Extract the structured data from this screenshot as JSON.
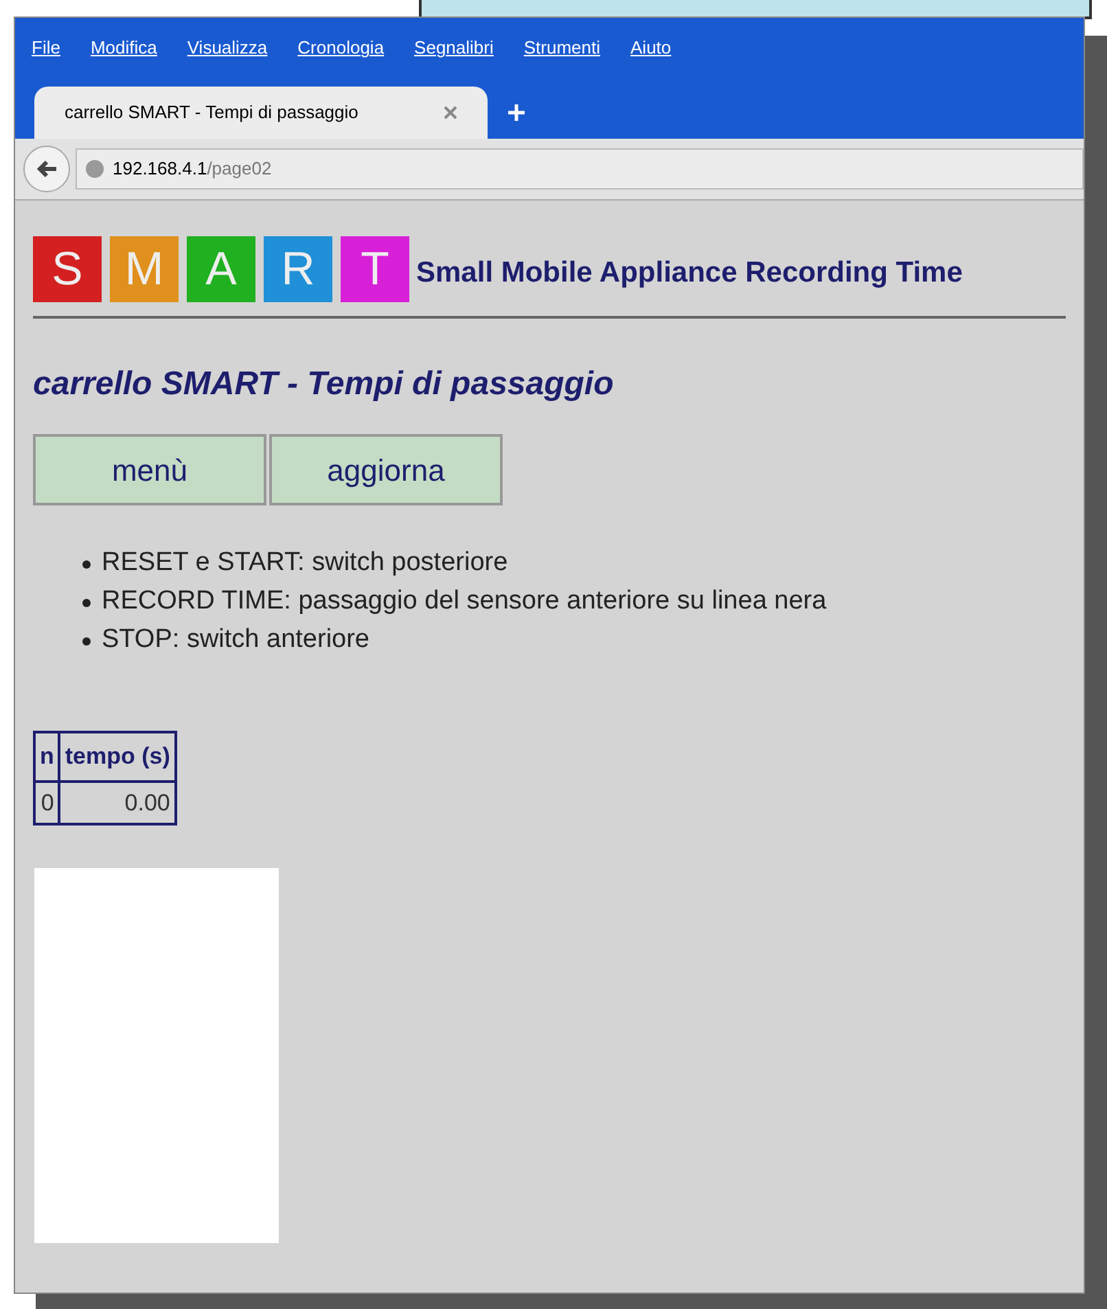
{
  "menu": [
    "File",
    "Modifica",
    "Visualizza",
    "Cronologia",
    "Segnalibri",
    "Strumenti",
    "Aiuto"
  ],
  "tabs": [
    {
      "label": "carrello SMART - Tempi di passaggio",
      "selected": true
    }
  ],
  "address": {
    "host": "192.168.4.1",
    "path": "/page02"
  },
  "logo": {
    "letters": [
      {
        "char": "S",
        "color": "#d42020"
      },
      {
        "char": "M",
        "color": "#e0901c"
      },
      {
        "char": "A",
        "color": "#20b020"
      },
      {
        "char": "R",
        "color": "#2090d8"
      },
      {
        "char": "T",
        "color": "#d820d8"
      }
    ],
    "tagline": "Small Mobile Appliance Recording Time"
  },
  "heading": "carrello SMART - Tempi di passaggio",
  "buttons": [
    "menù",
    "aggiorna"
  ],
  "notes": [
    "RESET e START: switch posteriore",
    "RECORD TIME: passaggio del sensore anteriore su linea nera",
    "STOP: switch anteriore"
  ],
  "table": {
    "columns": [
      "n",
      "tempo (s)"
    ],
    "rows": [
      [
        "0",
        "0.00"
      ]
    ]
  }
}
